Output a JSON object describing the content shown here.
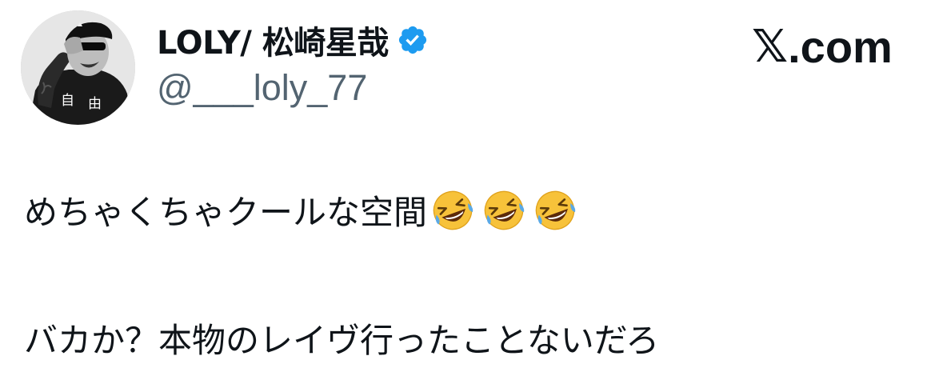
{
  "author": {
    "display_name": "LOLY/ 松崎星哉",
    "handle": "@___loly_77",
    "verified": true,
    "avatar_shirt_text": "自 由"
  },
  "brand": {
    "x_glyph": "𝕏",
    "text": ".com"
  },
  "tweet": {
    "line1_text": "めちゃくちゃクールな空間",
    "line1_emojis": [
      "rolling-on-floor-laughing",
      "rolling-on-floor-laughing",
      "rolling-on-floor-laughing"
    ],
    "line2_text": "バカか？本物のレイヴ行ったことないだろ"
  },
  "colors": {
    "text": "#0f1419",
    "secondary": "#536471",
    "verified": "#1d9bf0",
    "emoji_face": "#f7c23a",
    "tears": "#5aa9e6"
  }
}
